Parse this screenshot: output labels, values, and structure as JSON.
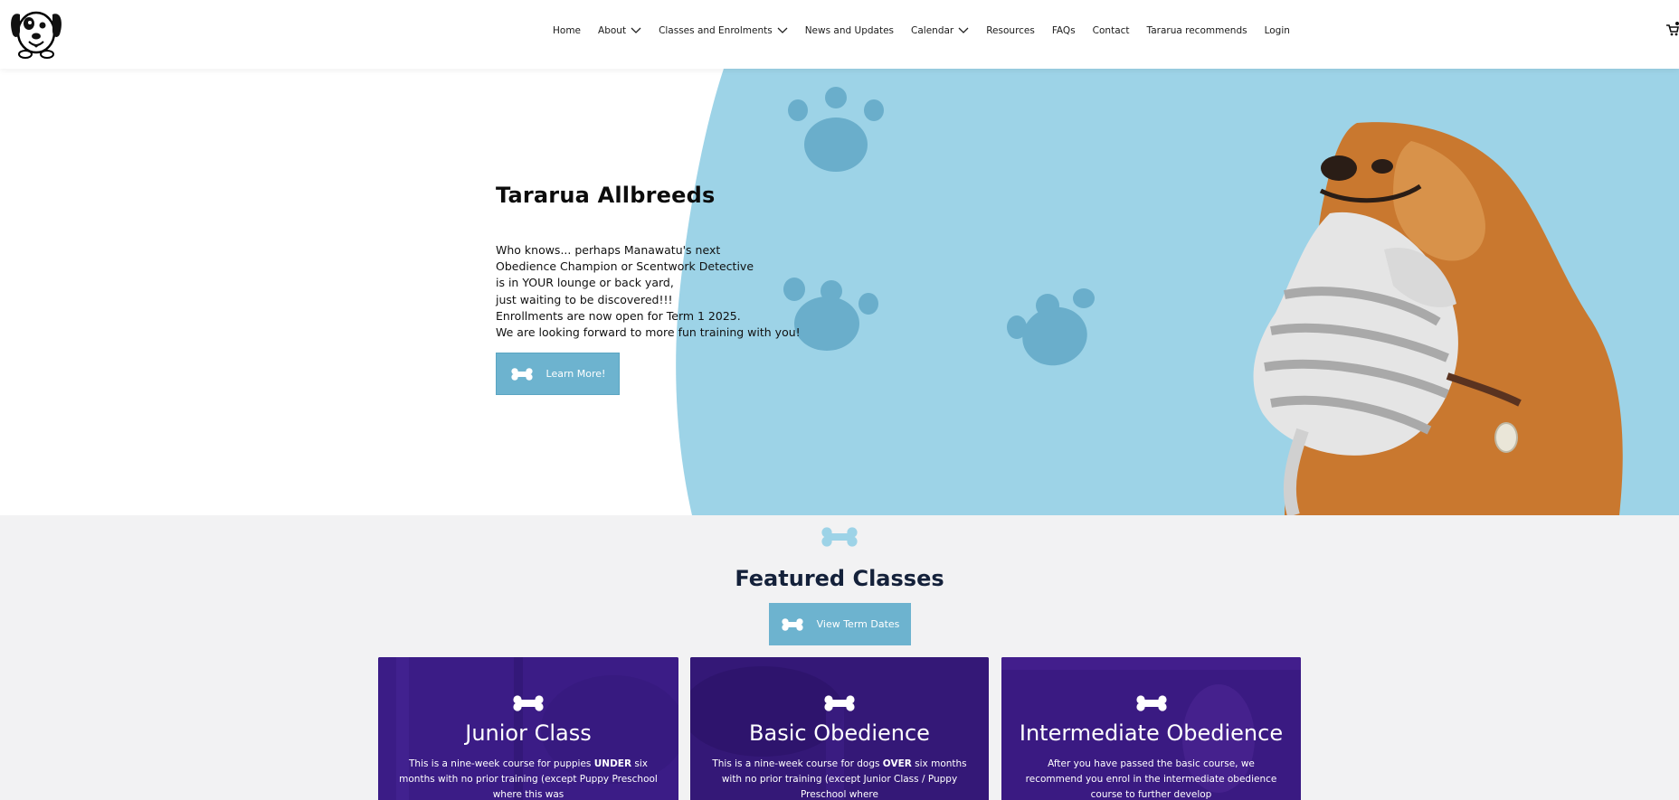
{
  "nav": {
    "items": [
      {
        "label": "Home",
        "has_dropdown": false
      },
      {
        "label": "About",
        "has_dropdown": true
      },
      {
        "label": "Classes and Enrolments",
        "has_dropdown": true
      },
      {
        "label": "News and Updates",
        "has_dropdown": false
      },
      {
        "label": "Calendar",
        "has_dropdown": true
      },
      {
        "label": "Resources",
        "has_dropdown": false
      },
      {
        "label": "FAQs",
        "has_dropdown": false
      },
      {
        "label": "Contact",
        "has_dropdown": false
      },
      {
        "label": "Tararua recommends",
        "has_dropdown": false
      },
      {
        "label": "Login",
        "has_dropdown": false
      }
    ],
    "cart_icon": "cart-icon",
    "logo_icon": "dog-logo"
  },
  "hero": {
    "title": "Tararua Allbreeds",
    "lines": [
      "Who knows... perhaps Manawatu's next",
      "Obedience Champion or Scentwork Detective",
      "is in YOUR lounge or back yard,",
      "just waiting to be discovered!!!",
      "Enrollments are now open for Term 1 2025.",
      "We are looking forward to more fun training with you!"
    ],
    "button_label": "Learn More!",
    "button_icon": "bone-icon"
  },
  "featured": {
    "title": "Featured Classes",
    "button_label": "View Term Dates",
    "cards": [
      {
        "title": "Junior Class",
        "text_pre": "This is a nine-week course for puppies ",
        "text_bold": "UNDER",
        "text_post": " six months with no prior training (except Puppy Preschool where this was"
      },
      {
        "title": "Basic Obedience",
        "text_pre": "This is a nine-week course for dogs ",
        "text_bold": "OVER",
        "text_post": " six months with no prior training (except Junior Class / Puppy Preschool where"
      },
      {
        "title": "Intermediate Obedience",
        "text_pre": "After you have passed the basic course, we recommend you enrol in the intermediate obedience course to further develop",
        "text_bold": "",
        "text_post": ""
      }
    ]
  },
  "colors": {
    "accent_blue": "#6db3cf",
    "hero_bg_blue": "#9dd3e7",
    "paw_blue": "#6aaecb",
    "card_purple": "#3a1a82",
    "section_bg": "#f2f2f3",
    "title_navy": "#14213a"
  }
}
